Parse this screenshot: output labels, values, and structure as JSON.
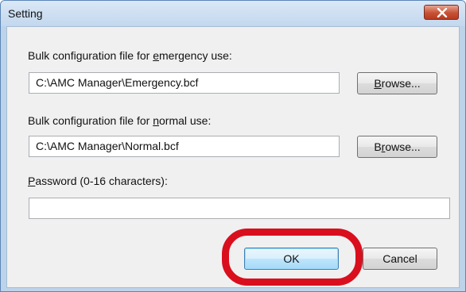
{
  "window": {
    "title": "Setting"
  },
  "emergency": {
    "label_pre": "Bulk configuration file for ",
    "label_key": "e",
    "label_post": "mergency use:",
    "value": "C:\\AMC Manager\\Emergency.bcf",
    "browse_key": "B",
    "browse_rest": "rowse..."
  },
  "normal": {
    "label_pre": "Bulk configuration file for ",
    "label_key": "n",
    "label_post": "ormal use:",
    "value": "C:\\AMC Manager\\Normal.bcf",
    "browse_pre": "B",
    "browse_key": "r",
    "browse_rest": "owse..."
  },
  "password": {
    "label_key": "P",
    "label_rest": "assword (0-16 characters):",
    "value": ""
  },
  "buttons": {
    "ok": "OK",
    "cancel": "Cancel"
  },
  "colors": {
    "highlight": "#d90f1e",
    "close_button": "#c75134"
  }
}
